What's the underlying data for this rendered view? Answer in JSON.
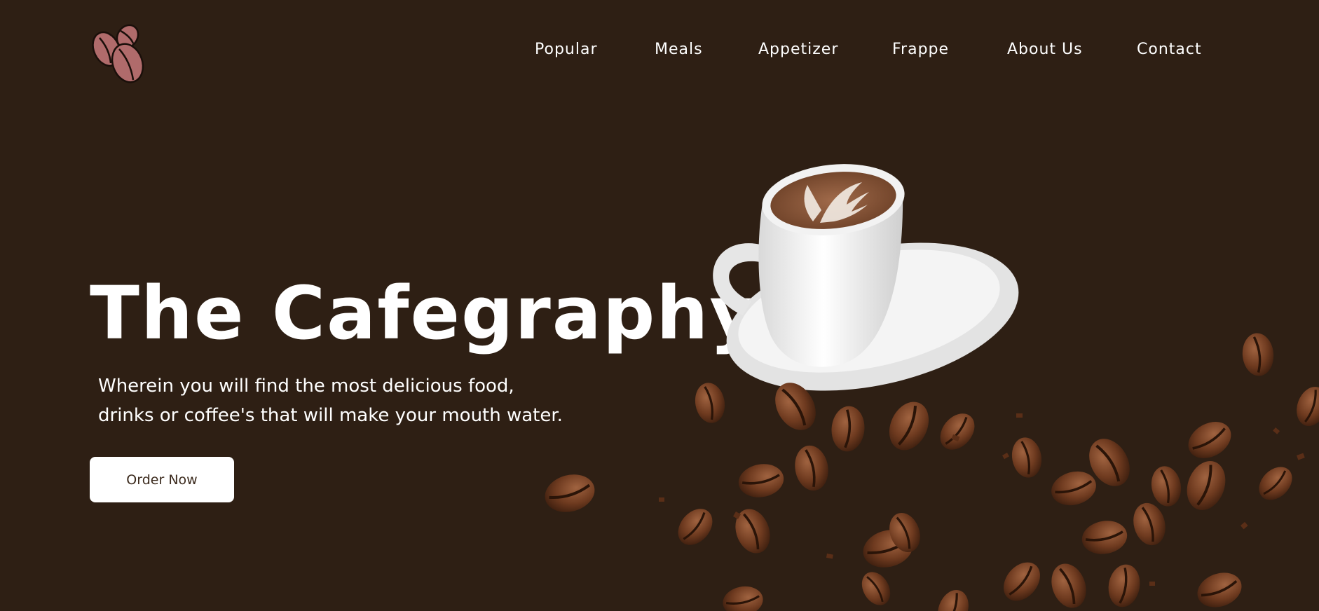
{
  "brand": {
    "logo_icon": "coffee-beans-logo-icon",
    "logo_color": "#b06b6b"
  },
  "nav": {
    "items": [
      {
        "label": "Popular"
      },
      {
        "label": "Meals"
      },
      {
        "label": "Appetizer"
      },
      {
        "label": "Frappe"
      },
      {
        "label": "About Us"
      },
      {
        "label": "Contact"
      }
    ]
  },
  "hero": {
    "title": "The Cafegraphy!",
    "subtitle_line1": "Wherein you will find the most delicious food,",
    "subtitle_line2": "drinks or coffee's that will make your mouth water.",
    "cta_label": "Order Now",
    "image": "coffee-cup-with-beans"
  },
  "colors": {
    "background": "#2e1f14",
    "text": "#ffffff",
    "button_bg": "#ffffff",
    "button_text": "#3b2a1d",
    "bean": "#7a4527"
  }
}
